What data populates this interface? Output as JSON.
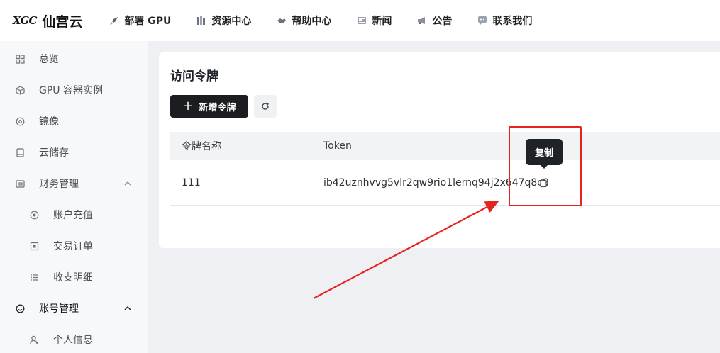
{
  "brand": {
    "mark": "XGC",
    "name": "仙宫云"
  },
  "topnav": {
    "items": [
      {
        "label": "部署 GPU",
        "icon": "rocket-icon"
      },
      {
        "label": "资源中心",
        "icon": "books-icon"
      },
      {
        "label": "帮助中心",
        "icon": "handshake-icon"
      },
      {
        "label": "新闻",
        "icon": "newspaper-icon"
      },
      {
        "label": "公告",
        "icon": "megaphone-icon"
      },
      {
        "label": "联系我们",
        "icon": "chat-icon"
      }
    ]
  },
  "sidebar": {
    "items": [
      {
        "label": "总览",
        "icon": "dashboard-icon"
      },
      {
        "label": "GPU 容器实例",
        "icon": "cube-icon"
      },
      {
        "label": "镜像",
        "icon": "disc-icon"
      },
      {
        "label": "云储存",
        "icon": "storage-icon"
      },
      {
        "label": "财务管理",
        "icon": "wallet-icon"
      },
      {
        "label": "账户充值",
        "icon": "recharge-icon"
      },
      {
        "label": "交易订单",
        "icon": "order-icon"
      },
      {
        "label": "收支明细",
        "icon": "list-icon"
      },
      {
        "label": "账号管理",
        "icon": "smile-icon"
      },
      {
        "label": "个人信息",
        "icon": "user-icon"
      }
    ]
  },
  "main": {
    "title": "访问令牌",
    "add_button": "新增令牌",
    "table": {
      "columns": [
        "令牌名称",
        "Token"
      ],
      "rows": [
        {
          "name": "111",
          "token": "ib42uznhvvg5vlr2qw9rio1lernq94j2x647q8c9"
        }
      ]
    },
    "tooltip": "复制"
  },
  "colors": {
    "accent_dark": "#1b1d21",
    "annotation_red": "#e8231d",
    "page_bg": "#eef0f4"
  }
}
